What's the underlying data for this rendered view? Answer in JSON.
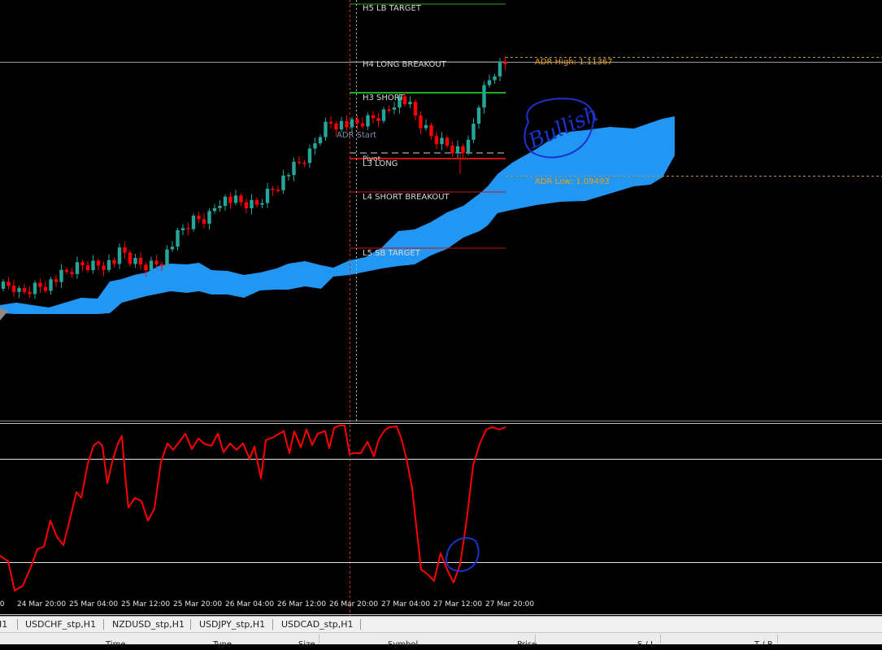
{
  "levels": {
    "h5": "H5 LB TARGET",
    "h4": "H4 LONG BREAKOUT",
    "h3": "H3 SHORT",
    "pivot": "Pivot",
    "l3": "L3 LONG",
    "l4": "L4 SHORT BREAKOUT",
    "l5": "L5 SB TARGET"
  },
  "adr": {
    "start": "ADR Start",
    "high": "ADR High: 1.11367",
    "low": "ADR Low: 1.09493"
  },
  "time_axis": [
    "24 Mar 20:00",
    "25 Mar 04:00",
    "25 Mar 12:00",
    "25 Mar 20:00",
    "26 Mar 04:00",
    "26 Mar 12:00",
    "26 Mar 20:00",
    "27 Mar 04:00",
    "27 Mar 12:00",
    "27 Mar 20:00"
  ],
  "tabs": [
    "H1",
    "USDCHF_stp,H1",
    "NZDUSD_stp,H1",
    "USDJPY_stp,H1",
    "USDCAD_stp,H1"
  ],
  "columns": [
    "Time",
    "Type",
    "Size",
    "Symbol",
    "Price",
    "S / L",
    "T / P"
  ],
  "annotations": {
    "handwriting": "Bullish"
  },
  "colors": {
    "background": "#000000",
    "bull_candle": "#26a69a",
    "bear_candle": "#ff0000",
    "cloud": "#2196f3",
    "oscillator": "#ff0000",
    "pen": "#1a33cc",
    "level_green": "#22aa22",
    "level_red": "#cc1111",
    "adr_label": "#e8a020"
  }
}
